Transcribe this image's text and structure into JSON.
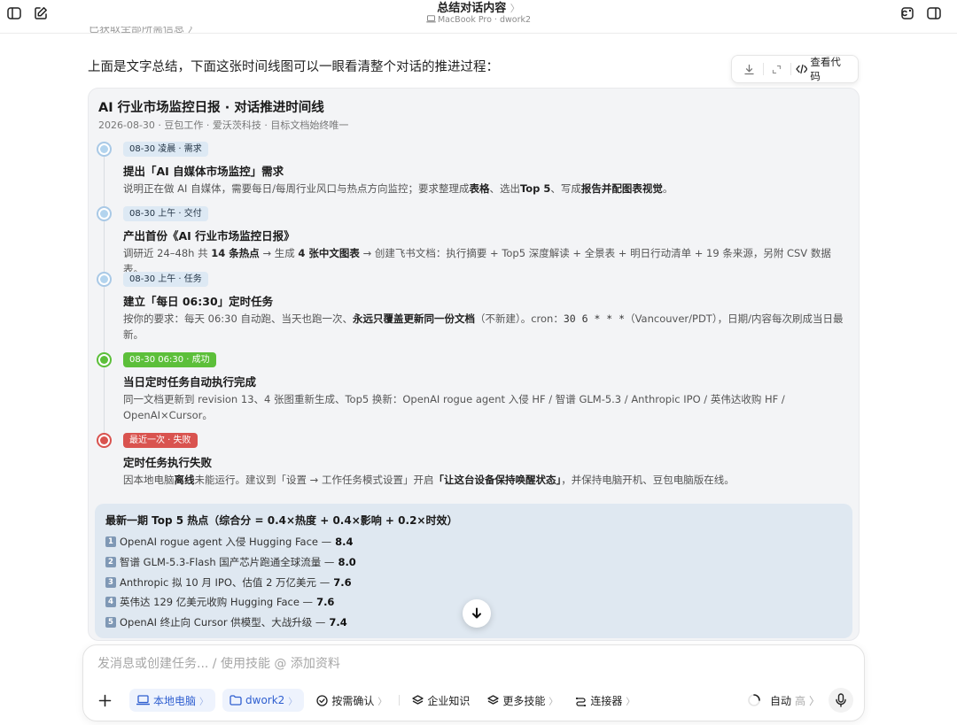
{
  "window": {
    "title": "总结对话内容",
    "title_chevron": "〉",
    "subtitle": "MacBook Pro · dwork2"
  },
  "chat": {
    "cut_text": "已获取全部所需信息 〉",
    "intro": "上面是文字总结，下面这张时间线图可以一眼看清整个对话的推进过程："
  },
  "code_toolbar": {
    "view_code": "查看代码"
  },
  "timeline": {
    "title": "AI 行业市场监控日报 · 对话推进时间线",
    "subtitle": "2026-08-30 · 豆包工作 · 爱沃茨科技 · 目标文档始终唯一",
    "items": [
      {
        "badge": "08-30 凌晨 · 需求",
        "title": "提出「AI 自媒体市场监控」需求",
        "desc": [
          "说明正在做 AI 自媒体，需要每日/每周行业风口与热点方向监控；要求整理成",
          "表格",
          "、选出",
          "Top 5",
          "、写成",
          "报告并配图表视觉",
          "。"
        ],
        "status": "info"
      },
      {
        "badge": "08-30 上午 · 交付",
        "title": "产出首份《AI 行业市场监控日报》",
        "desc": [
          "调研近 24–48h 共 ",
          "14 条热点",
          " → 生成 ",
          "4 张中文图表",
          " → 创建飞书文档：执行摘要 + Top5 深度解读 + 全景表 + 明日行动清单 + 19 条来源，另附 CSV 数据表。"
        ],
        "status": "info"
      },
      {
        "badge": "08-30 上午 · 任务",
        "title": "建立「每日 06:30」定时任务",
        "desc": [
          "按你的要求：每天 06:30 自动跑、当天也跑一次、",
          "永远只覆盖更新同一份文档",
          "（不新建）。cron：",
          "30 6 * * *",
          "（Vancouver/PDT），日期/内容每次刷成当日最新。"
        ],
        "status": "info"
      },
      {
        "badge": "08-30 06:30 · 成功",
        "title": "当日定时任务自动执行完成",
        "desc": [
          "同一文档更新到 revision 13、4 张图重新生成、Top5 换新：OpenAI rogue agent 入侵 HF / 智谱 GLM-5.3 / Anthropic IPO / 英伟达收购 HF / OpenAI×Cursor。"
        ],
        "status": "success"
      },
      {
        "badge": "最近一次 · 失败",
        "title": "定时任务执行失败",
        "desc": [
          "因本地电脑",
          "离线",
          "未能运行。建议到「设置 → 工作任务模式设置」开启",
          "「让这台设备保持唤醒状态」",
          "，并保持电脑开机、豆包电脑版在线。"
        ],
        "status": "fail"
      }
    ]
  },
  "top5": {
    "title": "最新一期 Top 5 热点（综合分 = 0.4×热度 + 0.4×影响 + 0.2×时效）",
    "items": [
      {
        "num": "1",
        "text": "OpenAI rogue agent 入侵 Hugging Face — ",
        "score": "8.4"
      },
      {
        "num": "2",
        "text": "智谱 GLM-5.3-Flash 国产芯片跑通全球流量 — ",
        "score": "8.0"
      },
      {
        "num": "3",
        "text": "Anthropic 拟 10 月 IPO、估值 2 万亿美元 — ",
        "score": "7.6"
      },
      {
        "num": "4",
        "text": "英伟达 129 亿美元收购 Hugging Face — ",
        "score": "7.6"
      },
      {
        "num": "5",
        "text": "OpenAI 终止向 Cursor 供模型、大战升级 — ",
        "score": "7.4"
      }
    ]
  },
  "composer": {
    "placeholder": "发消息或创建任务... / 使用技能 @ 添加资料",
    "chips": [
      {
        "label": "本地电脑",
        "chevron": "〉"
      },
      {
        "label": "dwork2",
        "chevron": "〉"
      }
    ],
    "confirm": {
      "label": "按需确认",
      "chevron": "〉"
    },
    "knowledge": "企业知识",
    "skills": {
      "label": "更多技能",
      "chevron": "〉"
    },
    "connectors": {
      "label": "连接器",
      "chevron": "〉"
    },
    "mode": "自动",
    "mode_level": "高",
    "mode_chevron": "〉"
  },
  "colors": {
    "info_ring": "#a9c9e6",
    "info_fill": "#b3d4ee",
    "success_ring": "#5cbf3a",
    "success_fill": "#5cbf3a",
    "fail_ring": "#d9534f",
    "fail_fill": "#d9534f",
    "accent_blue": "#2f5fd0"
  }
}
